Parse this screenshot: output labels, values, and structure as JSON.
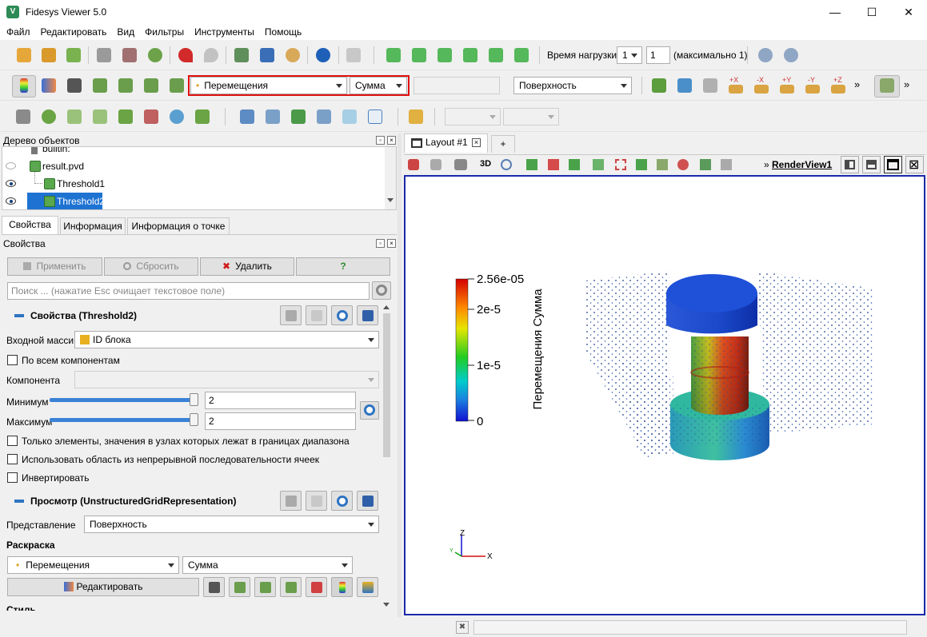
{
  "app_title": "Fidesys Viewer 5.0",
  "window_controls": {
    "minimize": "—",
    "maximize": "☐",
    "close": "✕"
  },
  "menu": [
    "Файл",
    "Редактировать",
    "Вид",
    "Фильтры",
    "Инструменты",
    "Помощь"
  ],
  "toolbar_time": {
    "label": "Время нагрузки:",
    "step_value": "1",
    "time_value": "1",
    "max_label": "(максимально 1)"
  },
  "toolbar_coloring": {
    "array": "Перемещения",
    "component": "Сумма",
    "representation": "Поверхность"
  },
  "view_direction_labels": [
    "+X",
    "-X",
    "+Y",
    "-Y",
    "+Z"
  ],
  "object_tree": {
    "title": "Дерево объектов",
    "items": [
      {
        "label": "builtin:",
        "visible": null
      },
      {
        "label": "result.pvd",
        "visible": false
      },
      {
        "label": "Threshold1",
        "visible": true
      },
      {
        "label": "Threshold2",
        "visible": true,
        "selected": true
      }
    ]
  },
  "tabs": [
    "Свойства",
    "Информация",
    "Информация о точке"
  ],
  "properties": {
    "title": "Свойства",
    "apply": "Применить",
    "reset": "Сбросить",
    "delete": "Удалить",
    "help": "?",
    "search_placeholder": "Поиск ... (нажатие Esc очищает текстовое поле)",
    "section_filter": "Свойства (Threshold2)",
    "input_array_label": "Входной массив",
    "input_array_value": "ID блока",
    "all_components": "По всем компонентам",
    "component_label": "Компонента",
    "min_label": "Минимум",
    "min_value": "2",
    "min_fraction": 1.0,
    "max_label": "Максимум",
    "max_value": "2",
    "max_fraction": 1.0,
    "opt_all_points": "Только элементы, значения в узлах которых лежат в границах диапазона",
    "opt_continuous": "Использовать область из непрерывной последовательности ячеек",
    "opt_invert": "Инвертировать",
    "section_display": "Просмотр (UnstructuredGridRepresentation)",
    "representation_label": "Представление",
    "representation_value": "Поверхность",
    "coloring_header": "Раскраска",
    "coloring_array": "Перемещения",
    "coloring_component": "Сумма",
    "edit_button": "Редактировать",
    "style_header": "Стиль"
  },
  "layout": {
    "tab": "Layout #1",
    "add_tab": "+",
    "view_label_3d": "3D",
    "render_view": "RenderView1"
  },
  "colorbar": {
    "title": "Перемещения Сумма",
    "max_label": "2.56e-05",
    "tick_2": "2e-5",
    "tick_1": "1e-5",
    "min_label": "0"
  },
  "axes": {
    "z": "Z",
    "x": "X",
    "y": "Y"
  },
  "colors": {
    "accent_blue": "#2f74c2",
    "render_border": "#1a2aa8",
    "highlight_red": "#e01010",
    "selection": "#1e73d2"
  }
}
